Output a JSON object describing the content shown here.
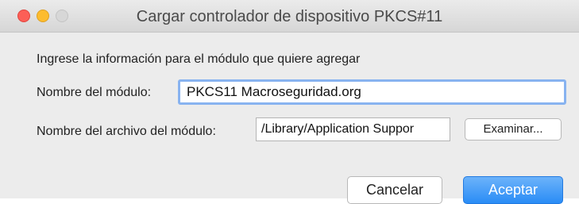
{
  "window": {
    "title": "Cargar controlador de dispositivo PKCS#11",
    "controls": {
      "close_color": "#fc5f57",
      "minimize_color": "#fdbc2e",
      "zoom_color": "#d7d7d7"
    }
  },
  "form": {
    "intro": "Ingrese la información para el módulo que quiere agregar",
    "module_name_label": "Nombre del módulo:",
    "module_name_value": "PKCS11 Macroseguridad.org",
    "module_file_label": "Nombre del archivo del módulo:",
    "module_file_value": "/Library/Application Suppor",
    "browse_label": "Examinar..."
  },
  "actions": {
    "cancel_label": "Cancelar",
    "accept_label": "Aceptar",
    "accent_color": "#2a8cf6"
  },
  "icons": {
    "close": "close-traffic-light-icon",
    "minimize": "minimize-traffic-light-icon",
    "zoom": "zoom-traffic-light-icon"
  }
}
